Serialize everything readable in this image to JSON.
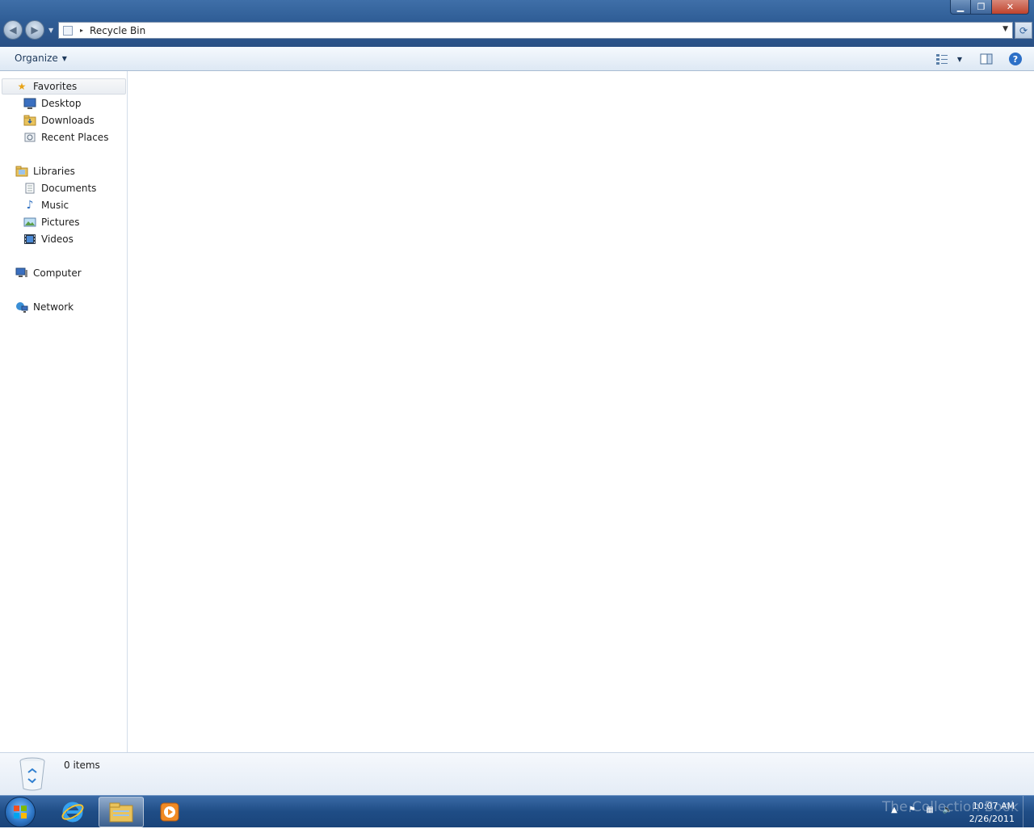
{
  "window": {
    "controls": {
      "min": "▁",
      "max": "❐",
      "close": "✕"
    }
  },
  "address": {
    "path": "Recycle Bin",
    "separator": "▸"
  },
  "toolbar": {
    "organize_label": "Organize",
    "organize_caret": "▼"
  },
  "nav": {
    "favorites": {
      "label": "Favorites",
      "items": [
        "Desktop",
        "Downloads",
        "Recent Places"
      ]
    },
    "libraries": {
      "label": "Libraries",
      "items": [
        "Documents",
        "Music",
        "Pictures",
        "Videos"
      ]
    },
    "computer": "Computer",
    "network": "Network"
  },
  "details": {
    "items_count": "0 items"
  },
  "taskbar": {
    "watermark": "The Collection Book",
    "time": "10:07 AM",
    "date": "2/26/2011"
  },
  "colors": {
    "titlebar": "#2f5d96",
    "taskbar": "#1f4d86",
    "nav_text": "#1e1e1e",
    "toolbar_text": "#1e395b"
  }
}
